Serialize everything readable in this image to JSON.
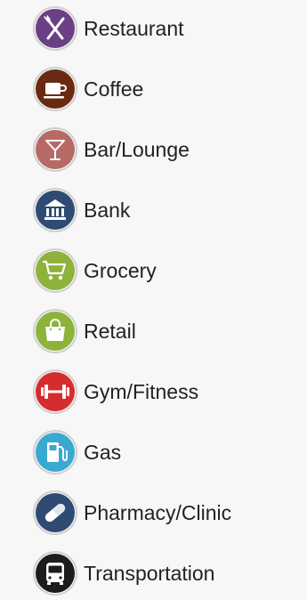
{
  "legend": {
    "items": [
      {
        "label": "Restaurant",
        "icon": "fork-knife-icon",
        "color": "#6b3f83"
      },
      {
        "label": "Coffee",
        "icon": "coffee-cup-icon",
        "color": "#6a2a12"
      },
      {
        "label": "Bar/Lounge",
        "icon": "cocktail-glass-icon",
        "color": "#b56a66"
      },
      {
        "label": "Bank",
        "icon": "bank-building-icon",
        "color": "#2f4a73"
      },
      {
        "label": "Grocery",
        "icon": "shopping-cart-icon",
        "color": "#8db33a"
      },
      {
        "label": "Retail",
        "icon": "shopping-bag-icon",
        "color": "#8db33a"
      },
      {
        "label": "Gym/Fitness",
        "icon": "dumbbell-icon",
        "color": "#d52c2f"
      },
      {
        "label": "Gas",
        "icon": "gas-pump-icon",
        "color": "#3aa9d1"
      },
      {
        "label": "Pharmacy/Clinic",
        "icon": "pill-capsule-icon",
        "color": "#2f4a73"
      },
      {
        "label": "Transportation",
        "icon": "bus-icon",
        "color": "#1c1c1c"
      }
    ]
  }
}
